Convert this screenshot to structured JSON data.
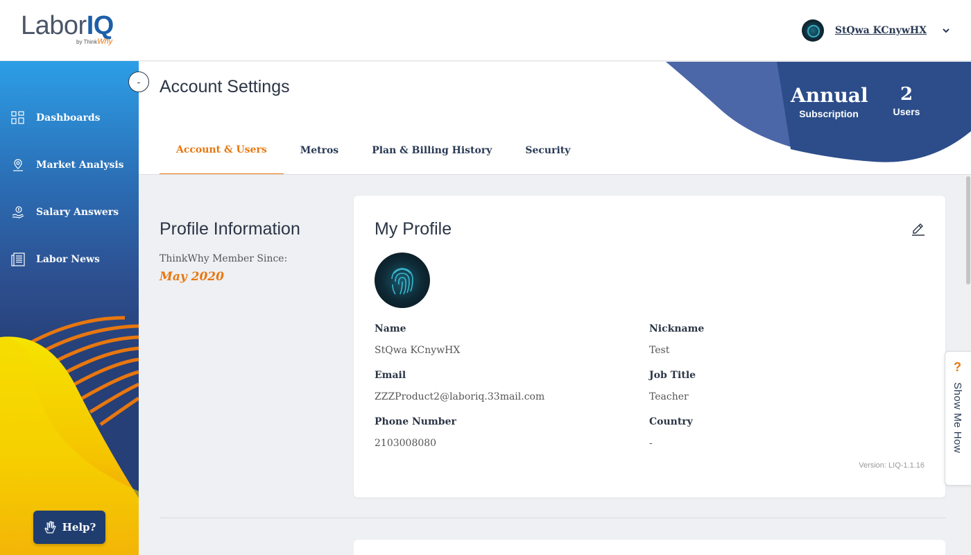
{
  "app": {
    "logo_text_main": "Labor",
    "logo_text_iq": "IQ",
    "logo_by": "by Think",
    "logo_why": "Why"
  },
  "header": {
    "user_name": "StQwa KCnywHX"
  },
  "sidebar": {
    "items": [
      {
        "label": "Dashboards",
        "icon": "dashboard-grid-icon"
      },
      {
        "label": "Market Analysis",
        "icon": "map-pin-icon"
      },
      {
        "label": "Salary Answers",
        "icon": "salary-hand-icon"
      },
      {
        "label": "Labor News",
        "icon": "newspaper-icon"
      }
    ],
    "help_label": "Help?",
    "collapse_label": "-"
  },
  "page": {
    "title": "Account Settings",
    "tabs": [
      {
        "label": "Account & Users",
        "active": true
      },
      {
        "label": "Metros",
        "active": false
      },
      {
        "label": "Plan & Billing History",
        "active": false
      },
      {
        "label": "Security",
        "active": false
      }
    ],
    "subscription": {
      "value": "Annual",
      "label": "Subscription"
    },
    "users": {
      "value": "2",
      "label": "Users"
    }
  },
  "profile_info": {
    "title": "Profile Information",
    "since_label": "ThinkWhy Member Since:",
    "since_date": "May 2020"
  },
  "my_profile": {
    "title": "My Profile",
    "fields": {
      "name": {
        "label": "Name",
        "value": "StQwa KCnywHX"
      },
      "nickname": {
        "label": "Nickname",
        "value": "Test"
      },
      "email": {
        "label": "Email",
        "value": "ZZZProduct2@laboriq.33mail.com"
      },
      "job_title": {
        "label": "Job Title",
        "value": "Teacher"
      },
      "phone": {
        "label": "Phone Number",
        "value": "2103008080"
      },
      "country": {
        "label": "Country",
        "value": "-"
      }
    },
    "version": "Version: LIQ-1.1.16"
  },
  "show_me_how": {
    "icon": "question-icon",
    "label": "Show Me How"
  },
  "colors": {
    "accent": "#e8770f",
    "navy": "#2a3a55",
    "sidebar_top": "#2c9ee6",
    "sidebar_bottom": "#263f76"
  }
}
